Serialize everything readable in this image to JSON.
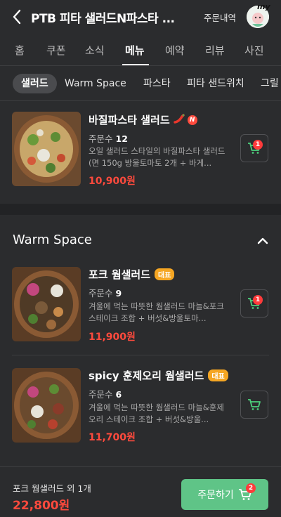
{
  "header": {
    "title": "PTB 피타 샐러드N파스타 ...",
    "order_history": "주문내역",
    "avatar_tag": "my"
  },
  "tabs": [
    {
      "label": "홈"
    },
    {
      "label": "쿠폰"
    },
    {
      "label": "소식"
    },
    {
      "label": "메뉴"
    },
    {
      "label": "예약"
    },
    {
      "label": "리뷰"
    },
    {
      "label": "사진"
    }
  ],
  "active_tab": "메뉴",
  "categories": [
    "샐러드",
    "Warm Space",
    "파스타",
    "피타 샌드위치",
    "그릴"
  ],
  "active_category": "샐러드",
  "items": [
    {
      "name": "바질파스타 샐러드",
      "badges": [
        "chili-pepper-icon",
        "new-badge"
      ],
      "new_badge": "N",
      "orders_label": "주문수",
      "orders": "12",
      "desc": "오일 샐러드 스타일의 바질파스타 샐러드 (면 150g 방울토마토 2개 + 바게...",
      "price": "10,900원",
      "cart_count": "1"
    },
    {
      "name": "포크 웜샐러드",
      "rep_badge": "대표",
      "orders_label": "주문수",
      "orders": "9",
      "desc": "겨울에 먹는 따뜻한 웜샐러드 마늘&포크 스테이크 조합 + 버섯&방울토마...",
      "price": "11,900원",
      "cart_count": "1"
    },
    {
      "name": "spicy 훈제오리 웜샐러드",
      "rep_badge": "대표",
      "orders_label": "주문수",
      "orders": "6",
      "desc": "겨울에 먹는 따뜻한 웜샐러드 마늘&훈제오리 스테이크 조합 + 버섯&방울...",
      "price": "11,700원",
      "cart_count": ""
    }
  ],
  "section": {
    "title": "Warm Space"
  },
  "bottom": {
    "summary": "포크 웜샐러드 외 1개",
    "total": "22,800원",
    "order_button": "주문하기",
    "order_count": "2"
  },
  "colors": {
    "accent_green": "#5fc487",
    "price_red": "#ff4a3d",
    "background": "#2b2c2e"
  }
}
